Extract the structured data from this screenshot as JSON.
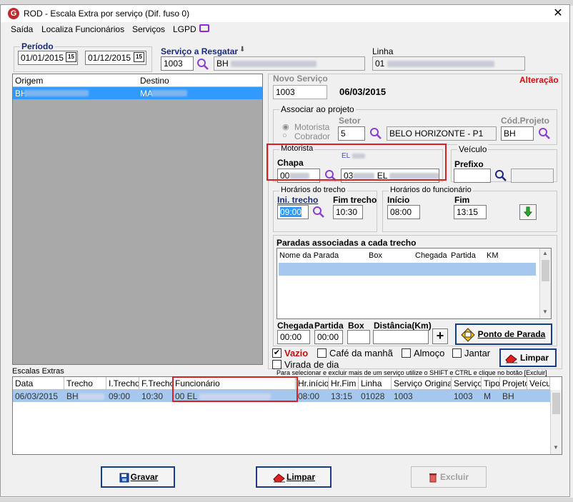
{
  "window": {
    "title": "ROD - Escala Extra por serviço (Dif. fuso 0)",
    "app_icon_letter": "G",
    "close": "✕"
  },
  "menu": [
    {
      "label": "Saída"
    },
    {
      "label": "Localiza Funcionários"
    },
    {
      "label": "Serviços"
    },
    {
      "label": "LGPD"
    }
  ],
  "periodo": {
    "label": "Período",
    "start": "01/01/2015",
    "end": "01/12/2015",
    "cal": "15"
  },
  "servico_resgatar": {
    "label": "Serviço a Resgatar",
    "code": "1003",
    "name_prefix": "BH"
  },
  "linha": {
    "label": "Linha",
    "code": "01"
  },
  "origem_destino": {
    "col_origem": "Origem",
    "col_destino": "Destino",
    "row": {
      "origem": "BH",
      "destino": "MA"
    }
  },
  "novo_servico": {
    "label": "Novo Serviço",
    "value": "1003",
    "date": "06/03/2015",
    "mode": "Alteração"
  },
  "projeto": {
    "group_title": "Associar ao projeto",
    "radio_motorista": "Motorista",
    "radio_cobrador": "Cobrador",
    "setor_label": "Setor",
    "setor_value": "5",
    "setor_name": "BELO HORIZONTE - P1",
    "cod_label": "Cód.Projeto",
    "cod_value": "BH"
  },
  "motorista": {
    "group_title": "Motorista",
    "name_prefix": "EL",
    "chapa_label": "Chapa",
    "chapa_value": "00",
    "func_code": "03",
    "func_name": "EL"
  },
  "veiculo": {
    "group_title": "Veículo",
    "prefixo_label": "Prefixo"
  },
  "horarios_trecho": {
    "group_title": "Horários do trecho",
    "ini_label": "Ini. trecho",
    "ini_value": "09:00",
    "fim_label": "Fim trecho",
    "fim_value": "10:30"
  },
  "horarios_func": {
    "group_title": "Horários do funcionário",
    "inicio_label": "Início",
    "inicio_value": "08:00",
    "fim_label": "Fim",
    "fim_value": "13:15"
  },
  "paradas": {
    "title": "Paradas associadas a cada trecho",
    "columns": [
      "Nome da Parada",
      "Box",
      "Chegada",
      "Partida",
      "KM"
    ],
    "chegada_label": "Chegada",
    "chegada_value": "00:00",
    "partida_label": "Partida",
    "partida_value": "00:00",
    "box_label": "Box",
    "distancia_label": "Distância(Km)",
    "add": "+",
    "ponto_button": "Ponto de Parada"
  },
  "options": {
    "vazio": "Vazio",
    "cafe": "Café da manhã",
    "almoco": "Almoço",
    "jantar": "Jantar",
    "virada": "Virada de dia",
    "limpar": "Limpar"
  },
  "escalas": {
    "label": "Escalas Extras",
    "hint": "Para selecionar e excluir mais de um serviço utilize o SHIFT e CTRL e clique no botão [Excluir]",
    "columns": [
      "Data",
      "Trecho",
      "I.Trecho",
      "F.Trecho",
      "Funcionário",
      "Hr.início",
      "Hr.Fim",
      "Linha",
      "Serviço Original",
      "Serviço",
      "Tipo",
      "Projeto",
      "Veícu"
    ],
    "row": [
      "06/03/2015",
      "BH",
      "09:00",
      "10:30",
      "00 EL",
      "08:00",
      "13:15",
      "01028",
      "1003",
      "1003",
      "M",
      "BH",
      ""
    ]
  },
  "buttons": {
    "gravar": "Gravar",
    "limpar": "Limpar",
    "excluir": "Excluir"
  }
}
